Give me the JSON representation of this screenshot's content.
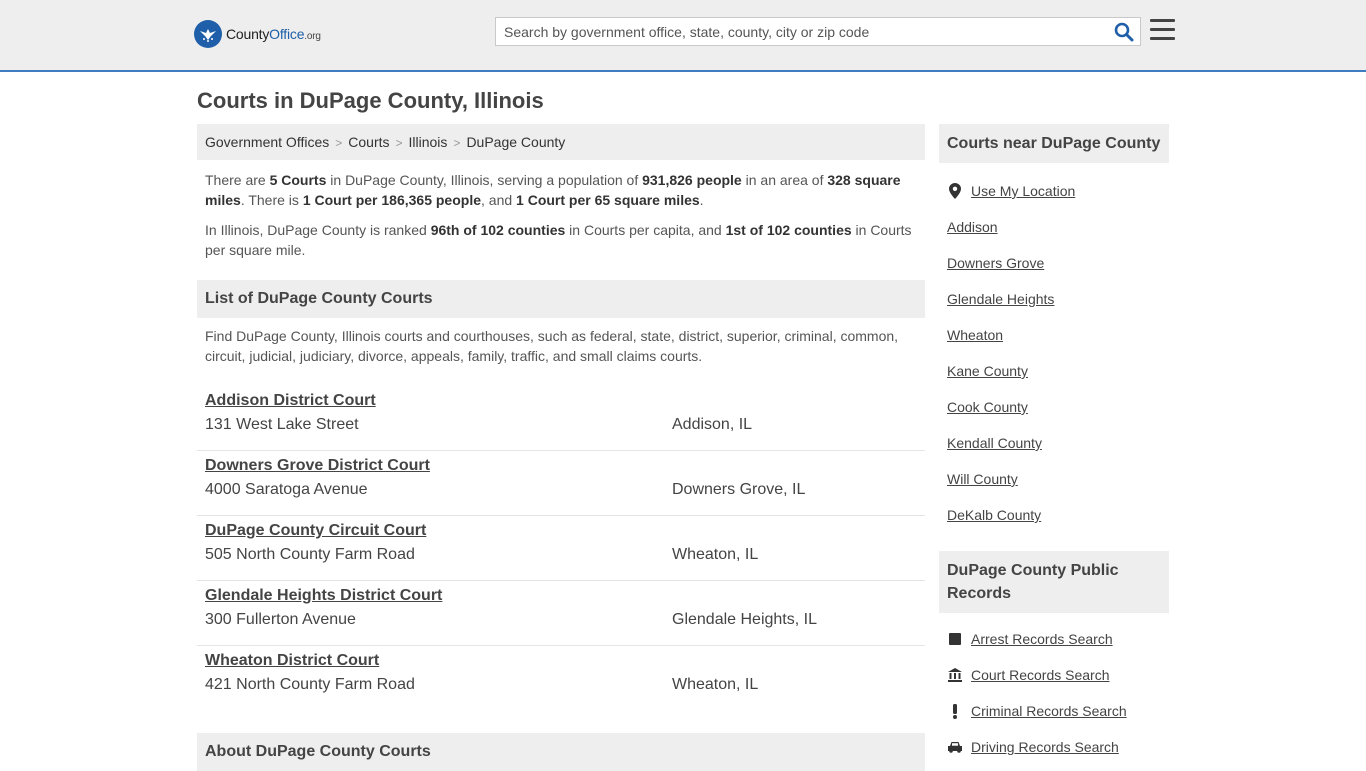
{
  "header": {
    "logo_main": "County",
    "logo_accent": "Office",
    "logo_tld": ".org",
    "search_placeholder": "Search by government office, state, county, city or zip code"
  },
  "page_title": "Courts in DuPage County, Illinois",
  "breadcrumb": [
    "Government Offices",
    "Courts",
    "Illinois",
    "DuPage County"
  ],
  "summary": {
    "p1": [
      "There are ",
      "5 Courts",
      " in DuPage County, Illinois, serving a population of ",
      "931,826 people",
      " in an area of ",
      "328 square miles",
      ". There is ",
      "1 Court per 186,365 people",
      ", and ",
      "1 Court per 65 square miles",
      "."
    ],
    "p2": [
      "In Illinois, DuPage County is ranked ",
      "96th of 102 counties",
      " in Courts per capita, and ",
      "1st of 102 counties",
      " in Courts per square mile."
    ]
  },
  "list": {
    "heading": "List of DuPage County Courts",
    "description": "Find DuPage County, Illinois courts and courthouses, such as federal, state, district, superior, criminal, common, circuit, judicial, judiciary, divorce, appeals, family, traffic, and small claims courts.",
    "courts": [
      {
        "name": "Addison District Court",
        "address": "131 West Lake Street",
        "city": "Addison, IL"
      },
      {
        "name": "Downers Grove District Court",
        "address": "4000 Saratoga Avenue",
        "city": "Downers Grove, IL"
      },
      {
        "name": "DuPage County Circuit Court",
        "address": "505 North County Farm Road",
        "city": "Wheaton, IL"
      },
      {
        "name": "Glendale Heights District Court",
        "address": "300 Fullerton Avenue",
        "city": "Glendale Heights, IL"
      },
      {
        "name": "Wheaton District Court",
        "address": "421 North County Farm Road",
        "city": "Wheaton, IL"
      }
    ]
  },
  "about_heading": "About DuPage County Courts",
  "sidebar": {
    "nearby_heading": "Courts near DuPage County",
    "use_location": "Use My Location",
    "nearby": [
      "Addison",
      "Downers Grove",
      "Glendale Heights",
      "Wheaton",
      "Kane County",
      "Cook County",
      "Kendall County",
      "Will County",
      "DeKalb County"
    ],
    "records_heading": "DuPage County Public Records",
    "records": [
      {
        "label": "Arrest Records Search",
        "icon": "square-icon"
      },
      {
        "label": "Court Records Search",
        "icon": "courthouse-icon"
      },
      {
        "label": "Criminal Records Search",
        "icon": "exclamation-icon"
      },
      {
        "label": "Driving Records Search",
        "icon": "car-icon"
      }
    ]
  },
  "colors": {
    "brand": "#1f5ea8",
    "header_border": "#3f7cc2",
    "panel_bg": "#eeeeee"
  }
}
